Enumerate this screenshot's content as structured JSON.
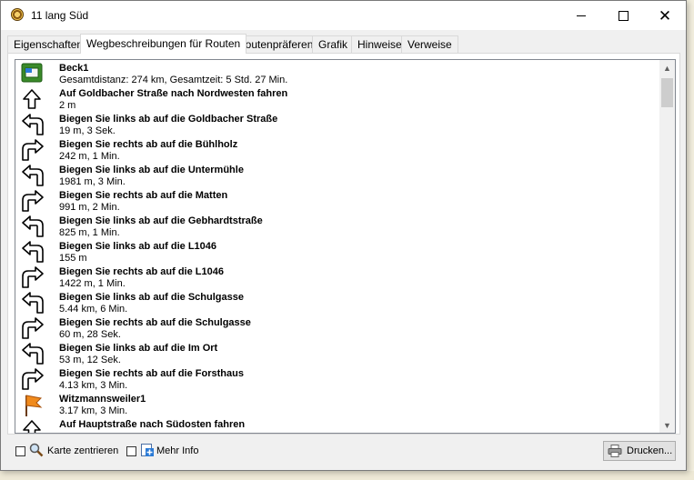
{
  "window": {
    "title": "11 lang Süd"
  },
  "tabs": [
    {
      "label": "Eigenschaften",
      "active": false
    },
    {
      "label": "Wegbeschreibungen für Routen",
      "active": true
    },
    {
      "label": "Routenpräferenz",
      "active": false
    },
    {
      "label": "Grafik",
      "active": false
    },
    {
      "label": "Hinweise",
      "active": false
    },
    {
      "label": "Verweise",
      "active": false
    }
  ],
  "directions": [
    {
      "icon": "start-flag",
      "title": "Beck1",
      "detail": "Gesamtdistanz: 274 km, Gesamtzeit: 5 Std. 27 Min."
    },
    {
      "icon": "arrow-up",
      "title": "Auf Goldbacher Straße nach Nordwesten fahren",
      "detail": "2 m"
    },
    {
      "icon": "turn-left",
      "title": "Biegen Sie links ab auf die Goldbacher Straße",
      "detail": "19 m, 3 Sek."
    },
    {
      "icon": "turn-right",
      "title": "Biegen Sie rechts ab auf die Bühlholz",
      "detail": "242 m, 1 Min."
    },
    {
      "icon": "turn-left",
      "title": "Biegen Sie links ab auf die Untermühle",
      "detail": "1981 m, 3 Min."
    },
    {
      "icon": "turn-right",
      "title": "Biegen Sie rechts ab auf die Matten",
      "detail": "991 m, 2 Min."
    },
    {
      "icon": "turn-left",
      "title": "Biegen Sie links ab auf die Gebhardtstraße",
      "detail": "825 m, 1 Min."
    },
    {
      "icon": "turn-left",
      "title": "Biegen Sie links ab auf die L1046",
      "detail": "155 m"
    },
    {
      "icon": "turn-right",
      "title": "Biegen Sie rechts ab auf die L1046",
      "detail": "1422 m, 1 Min."
    },
    {
      "icon": "turn-left",
      "title": "Biegen Sie links ab auf die Schulgasse",
      "detail": "5.44 km, 6 Min."
    },
    {
      "icon": "turn-right",
      "title": "Biegen Sie rechts ab auf die Schulgasse",
      "detail": "60 m, 28 Sek."
    },
    {
      "icon": "turn-left",
      "title": "Biegen Sie links ab auf die Im Ort",
      "detail": "53 m, 12 Sek."
    },
    {
      "icon": "turn-right",
      "title": "Biegen Sie rechts ab auf die Forsthaus",
      "detail": "4.13 km, 3 Min."
    },
    {
      "icon": "waypoint-flag",
      "title": "Witzmannsweiler1",
      "detail": "3.17 km, 3 Min."
    },
    {
      "icon": "arrow-up",
      "title": "Auf Hauptstraße nach Südosten fahren",
      "detail": ""
    }
  ],
  "bottom": {
    "center_map_label": "Karte zentrieren",
    "more_info_label": "Mehr Info",
    "print_label": "Drucken..."
  },
  "colors": {
    "flag_orange": "#f08a1c",
    "start_green": "#3a8a2a"
  }
}
